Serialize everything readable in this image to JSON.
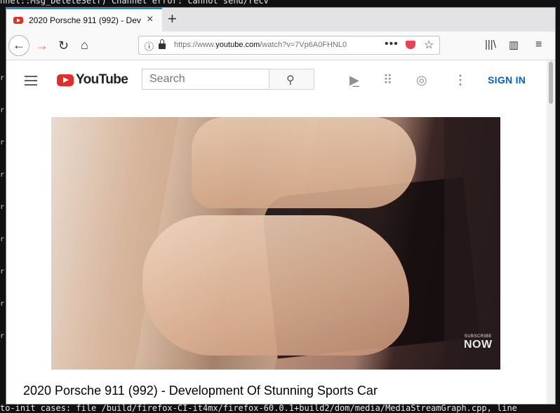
{
  "terminal": {
    "top_line": "nnel::Msg_DeleteSelf) Channel error: cannot send/recv",
    "bottom_line": "to-init cases: file /build/firefox-CI-it4mx/firefox-60.0.1+build2/dom/media/MediaStreamGraph.cpp, line"
  },
  "browser": {
    "tab": {
      "title": "2020 Porsche 911 (992) - Development Of Stunning Sports Car"
    },
    "url": {
      "prefix": "https://www.",
      "host": "youtube.com",
      "path": "/watch?v=7Vp6A0FHNL0"
    }
  },
  "youtube": {
    "logo_text": "YouTube",
    "search_placeholder": "Search",
    "signin_label": "SIGN IN",
    "video": {
      "title": "2020 Porsche 911 (992) - Development Of Stunning Sports Car",
      "watermark_top": "SUBSCRIBE",
      "watermark_main": "NOW"
    }
  },
  "icons": {
    "back": "arrow-left",
    "forward": "arrow-right",
    "reload": "reload",
    "home": "home",
    "site_info": "info",
    "lock": "lock",
    "page_actions": "more-horizontal",
    "pocket": "pocket",
    "bookmark": "star",
    "library": "library",
    "sidebar": "sidebar",
    "menu": "hamburger",
    "yt_menu": "hamburger",
    "search": "magnifier",
    "create": "video-camera",
    "apps": "grid",
    "messages": "chat",
    "settings": "more-vertical"
  },
  "colors": {
    "youtube_red": "#e52d27",
    "link_blue": "#065fd4",
    "tab_accent": "#0a84ff",
    "forward_arrow": "#ff7139"
  }
}
